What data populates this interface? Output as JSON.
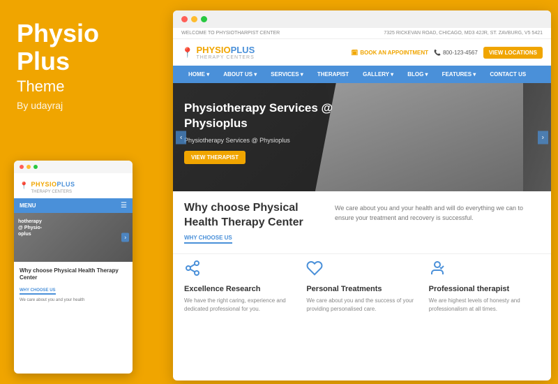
{
  "left": {
    "title_line1": "Physio",
    "title_line2": "Plus",
    "subtitle": "Theme",
    "by": "By udayraj"
  },
  "mobile": {
    "logo_text": "PHYSIO",
    "logo_plus": "PLUS",
    "logo_sub": "THERAPY CENTERS",
    "nav_label": "MENU",
    "hero_text_line1": "hotherapy",
    "hero_text_line2": "@ Physio-",
    "hero_text_line3": "oplus",
    "section_title": "Why choose Physical Health Therapy Center",
    "why_label": "WHY CHOOSE US",
    "body_text": "We care about you and your health"
  },
  "browser": {
    "topbar_left": "WELCOME TO PHYSIOTHARPIST CENTER",
    "topbar_right": "7325 RICKEVAN ROAD, CHICAGO, MD3 42JR, ST. ZAVBURG, V5 5421",
    "logo_text": "PHYSIO",
    "logo_plus": "PLUS",
    "logo_sub": "THERAPY CENTERS",
    "appt_label": "BOOK AN APPOINTMENT",
    "phone": "800-123-4567",
    "locations_btn": "VIEW LOCATIONS",
    "nav_items": [
      "HOME",
      "ABOUT US",
      "SERVICES",
      "THERAPIST",
      "GALLERY",
      "BLOG",
      "FEATURES",
      "CONTACT US"
    ],
    "hero_title": "Physiotherapy Services @ Physioplus",
    "hero_subtitle": "Physiotherapy Services @ Physioplus",
    "hero_btn": "VIEW THERAPIST",
    "why_label": "WHY CHOOSE US",
    "why_title": "Why choose Physical Health Therapy Center",
    "why_text": "We care about you and your health and will do everything we can to ensure your treatment and recovery is successful.",
    "feature1_title": "Excellence Research",
    "feature1_text": "We have the right caring, experience and dedicated professional for you.",
    "feature2_title": "Personal Treatments",
    "feature2_text": "We care about you and the success of your providing personalised care.",
    "feature3_title": "Professional therapist",
    "feature3_text": "We are highest levels of honesty and professionalism at all times."
  }
}
